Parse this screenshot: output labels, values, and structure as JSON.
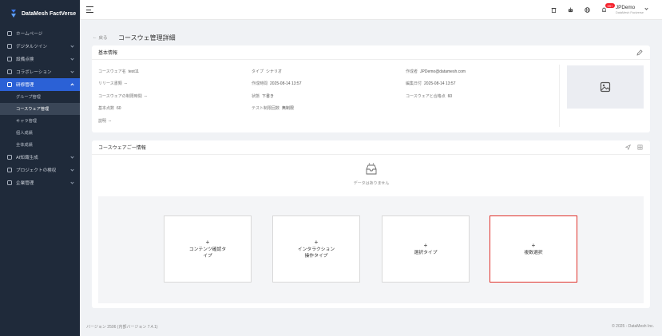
{
  "app": {
    "name": "DataMesh FactVerse"
  },
  "sidebar": {
    "items": [
      {
        "label": "ホームページ",
        "icon": "home-icon",
        "expandable": false
      },
      {
        "label": "デジタルツイン",
        "icon": "cube-icon",
        "expandable": true
      },
      {
        "label": "設備点検",
        "icon": "clipboard-icon",
        "expandable": true
      },
      {
        "label": "コラボレーション",
        "icon": "collab-icon",
        "expandable": true
      },
      {
        "label": "研修管理",
        "icon": "training-icon",
        "expandable": true,
        "active": true
      }
    ],
    "subitems": [
      {
        "label": "グループ管理"
      },
      {
        "label": "コースウェア管理",
        "selected": true
      },
      {
        "label": "キャラ管理"
      },
      {
        "label": "個人成績"
      },
      {
        "label": "全体成績"
      }
    ],
    "items_after": [
      {
        "label": "AI知識生成",
        "icon": "ai-icon",
        "expandable": true
      },
      {
        "label": "プロジェクトの検収",
        "icon": "project-icon",
        "expandable": true
      },
      {
        "label": "企業管理",
        "icon": "enterprise-icon",
        "expandable": true
      }
    ]
  },
  "header": {
    "notification_badge": "99+",
    "user_name": "JPDemo",
    "user_sub": "DataMesh Factverse"
  },
  "page": {
    "back_label": "戻る",
    "title": "コースウェ管理詳細"
  },
  "basic_info": {
    "title": "基本情報",
    "fields": {
      "name": {
        "label": "コースウェア名",
        "value": "test11"
      },
      "type": {
        "label": "タイプ",
        "value": "シナリオ"
      },
      "creator": {
        "label": "作成者",
        "value": "JPDemo@datamesh.com"
      },
      "release": {
        "label": "リリース書類",
        "value": "--"
      },
      "created": {
        "label": "作成時間",
        "value": "2025-08-14 13:57"
      },
      "edited": {
        "label": "編集日付",
        "value": "2025-08-14 13:57"
      },
      "time_limit": {
        "label": "コースウェアの制限時間",
        "value": "--"
      },
      "status": {
        "label": "状態",
        "value": "下書き"
      },
      "pass_score": {
        "label": "コースウェアと合格点",
        "value": "60"
      },
      "base_score": {
        "label": "基本点数",
        "value": "60"
      },
      "test_limit": {
        "label": "テスト制限回数",
        "value": "無制限"
      },
      "description": {
        "label": "説明",
        "value": "--"
      }
    }
  },
  "courseware_info": {
    "title": "コースウェアごー情報",
    "empty_text": "データはありません",
    "types": [
      {
        "plus": "+",
        "label": "コンテンツ確認タ\nイプ"
      },
      {
        "plus": "+",
        "label": "インタラクション\n操作タイプ"
      },
      {
        "plus": "+",
        "label": "選択タイプ"
      },
      {
        "plus": "+",
        "label": "複数選択",
        "highlighted": true
      }
    ]
  },
  "footer": {
    "version": "バージョン 2506 (内部バージョン 7.4.1)",
    "copyright": "© 2025 - DataMesh Inc."
  },
  "colors": {
    "sidebar_bg": "#1f2a3a",
    "accent": "#2b61d6",
    "highlight_border": "#e0312b"
  }
}
